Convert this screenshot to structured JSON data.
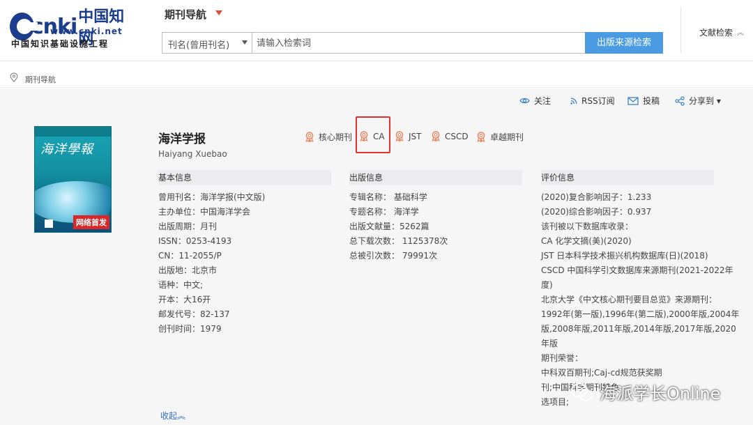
{
  "header": {
    "logo_cn_text": "中国知网",
    "logo_brand": "cnki",
    "logo_url": "www.cnki.net",
    "logo_sub": "中国知识基础设施工程",
    "nav_title": "期刊导航",
    "search_select_value": "刊名(曾用刊名)",
    "search_placeholder": "请输入检索词",
    "search_button": "出版来源检索",
    "lit_search": "文献检索",
    "lit_search_caret": "︽"
  },
  "breadcrumb": {
    "text": "期刊导航"
  },
  "toolbar": {
    "follow": "关注",
    "rss": "RSS订阅",
    "submit": "投稿",
    "share": "分享到 ▾"
  },
  "cover": {
    "title": "海洋學報",
    "stamp": "网络首发"
  },
  "journal": {
    "title": "海洋学报",
    "pinyin": "Haiyang Xuebao",
    "badges": [
      "核心期刊",
      "CA",
      "JST",
      "CSCD",
      "卓越期刊"
    ]
  },
  "basic_info": {
    "heading": "基本信息",
    "rows": [
      "曾用刊名：海洋学报(中文版)",
      "主办单位：中国海洋学会",
      "出版周期：月刊",
      "ISSN：0253-4193",
      "CN：11-2055/P",
      "出版地：北京市",
      "语种：中文;",
      "开本：大16开",
      "邮发代号：82-137",
      "创刊时间：1979"
    ]
  },
  "publish_info": {
    "heading": "出版信息",
    "rows": [
      "专辑名称：  基础科学",
      "专题名称：  海洋学",
      "出版文献量：5262篇",
      "总下载次数：  1125378次",
      "总被引次数：  79991次"
    ]
  },
  "eval_info": {
    "heading": "评价信息",
    "rows": [
      "(2020)复合影响因子：1.233",
      "(2020)综合影响因子：0.937",
      "该刊被以下数据库收录：",
      "CA 化学文摘(美)(2020)",
      "JST 日本科学技术振兴机构数据库(日)(2018)",
      "CSCD 中国科学引文数据库来源期刊(2021-2022年",
      "度)",
      "北京大学《中文核心期刊要目总览》来源期刊：",
      "1992年(第一版),1996年(第二版),2000年版,2004年",
      "版,2008年版,2011年版,2014年版,2017年版,2020",
      "年版",
      "期刊荣誉：",
      "中科双百期刊;Caj-cd规范获奖期",
      "刊;中国科学期刊特色",
      "选项目;"
    ]
  },
  "collapse_link": "收起︽",
  "watermark": {
    "text": "海派学长Online"
  },
  "colors": {
    "accent": "#4a9be2",
    "highlight": "#e3322f",
    "badge": "#e8805a"
  }
}
